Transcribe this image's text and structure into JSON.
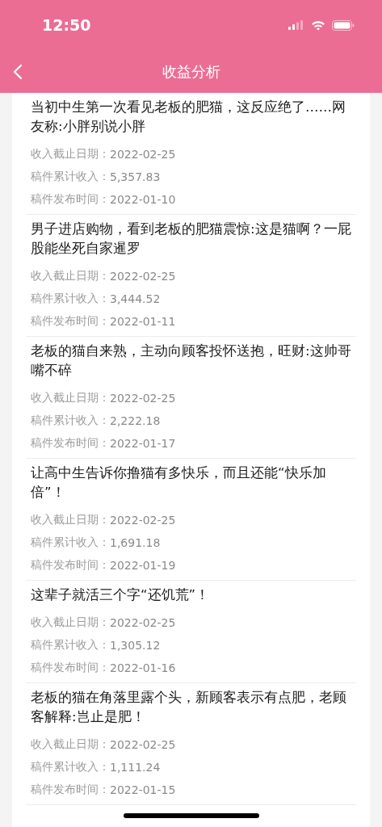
{
  "status_bar": {
    "time": "12:50"
  },
  "nav": {
    "title": "收益分析"
  },
  "articles": [
    {
      "title": "当初中生第一次看见老板的肥猫，这反应绝了……网友称:小胖别说小胖",
      "fields": [
        {
          "label": "收入截止日期：",
          "value": "2022-02-25"
        },
        {
          "label": "稿件累计收入：",
          "value": "5,357.83"
        },
        {
          "label": "稿件发布时间：",
          "value": "2022-01-10"
        }
      ]
    },
    {
      "title": "男子进店购物，看到老板的肥猫震惊:这是猫啊？一屁股能坐死自家暹罗",
      "fields": [
        {
          "label": "收入截止日期：",
          "value": "2022-02-25"
        },
        {
          "label": "稿件累计收入：",
          "value": "3,444.52"
        },
        {
          "label": "稿件发布时间：",
          "value": "2022-01-11"
        }
      ]
    },
    {
      "title": "老板的猫自来熟，主动向顾客投怀送抱，旺财:这帅哥嘴不碎",
      "fields": [
        {
          "label": "收入截止日期：",
          "value": "2022-02-25"
        },
        {
          "label": "稿件累计收入：",
          "value": "2,222.18"
        },
        {
          "label": "稿件发布时间：",
          "value": "2022-01-17"
        }
      ]
    },
    {
      "title": "让高中生告诉你撸猫有多快乐，而且还能“快乐加倍”！",
      "fields": [
        {
          "label": "收入截止日期：",
          "value": "2022-02-25"
        },
        {
          "label": "稿件累计收入：",
          "value": "1,691.18"
        },
        {
          "label": "稿件发布时间：",
          "value": "2022-01-19"
        }
      ]
    },
    {
      "title": "这辈子就活三个字“还饥荒”！",
      "fields": [
        {
          "label": "收入截止日期：",
          "value": "2022-02-25"
        },
        {
          "label": "稿件累计收入：",
          "value": "1,305.12"
        },
        {
          "label": "稿件发布时间：",
          "value": "2022-01-16"
        }
      ]
    },
    {
      "title": "老板的猫在角落里露个头，新顾客表示有点肥，老顾客解释:岂止是肥！",
      "fields": [
        {
          "label": "收入截止日期：",
          "value": "2022-02-25"
        },
        {
          "label": "稿件累计收入：",
          "value": "1,111.24"
        },
        {
          "label": "稿件发布时间：",
          "value": "2022-01-15"
        }
      ]
    }
  ]
}
